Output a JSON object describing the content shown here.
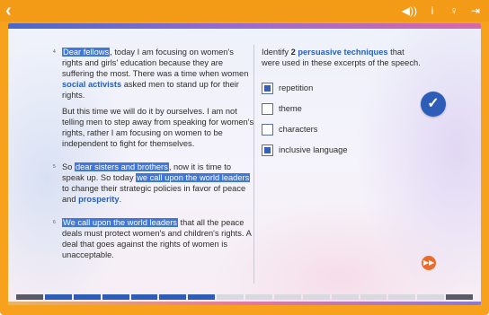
{
  "header": {
    "back_icon": "‹",
    "icons": [
      {
        "name": "volume-icon",
        "glyph": "◀))"
      },
      {
        "name": "info-icon",
        "glyph": "i"
      },
      {
        "name": "hint-icon",
        "glyph": "♀"
      },
      {
        "name": "exit-icon",
        "glyph": "⇥"
      }
    ]
  },
  "passage": {
    "p4": {
      "num": "4",
      "hl_1": "Dear fellows",
      "text_1": ", today I am focusing on women's rights and girls' education because they are suffering the most. There was a time when women ",
      "kw_1": "social activists",
      "text_2": " asked men to stand up for their rights."
    },
    "p4b": "But this time we will do it by ourselves. I am not telling men to step away from speaking for women's rights, rather I am focusing on women to be independent to fight for themselves.",
    "p5": {
      "num": "5",
      "text_1": "So ",
      "hl_1": "dear sisters and brothers",
      "text_2": ", now it is time to speak up. So today ",
      "hl_2": "we call upon the world leaders",
      "text_3": " to change their strategic policies in favor of peace and ",
      "kw_1": "prosperity",
      "text_4": "."
    },
    "p6": {
      "num": "6",
      "hl_1": "We call upon the world leaders",
      "text_1": " that all the peace deals must protect women's and children's rights. A deal that goes against the rights of women is unacceptable."
    }
  },
  "question": {
    "part_1": "Identify ",
    "num": "2",
    "kw": "persuasive techniques",
    "part_2": " that were used in these excerpts of the speech."
  },
  "options": [
    {
      "label": "repetition",
      "checked": true
    },
    {
      "label": "theme",
      "checked": false
    },
    {
      "label": "characters",
      "checked": false
    },
    {
      "label": "inclusive language",
      "checked": true
    }
  ],
  "buttons": {
    "check_glyph": "✓",
    "next_glyph": "▶▶"
  },
  "progress": {
    "segments": 16,
    "completed": 6
  },
  "colors": {
    "frame": "#f7a11c",
    "accent": "#2e5db8",
    "highlight": "#3f78d8",
    "next": "#ec6a2a"
  }
}
